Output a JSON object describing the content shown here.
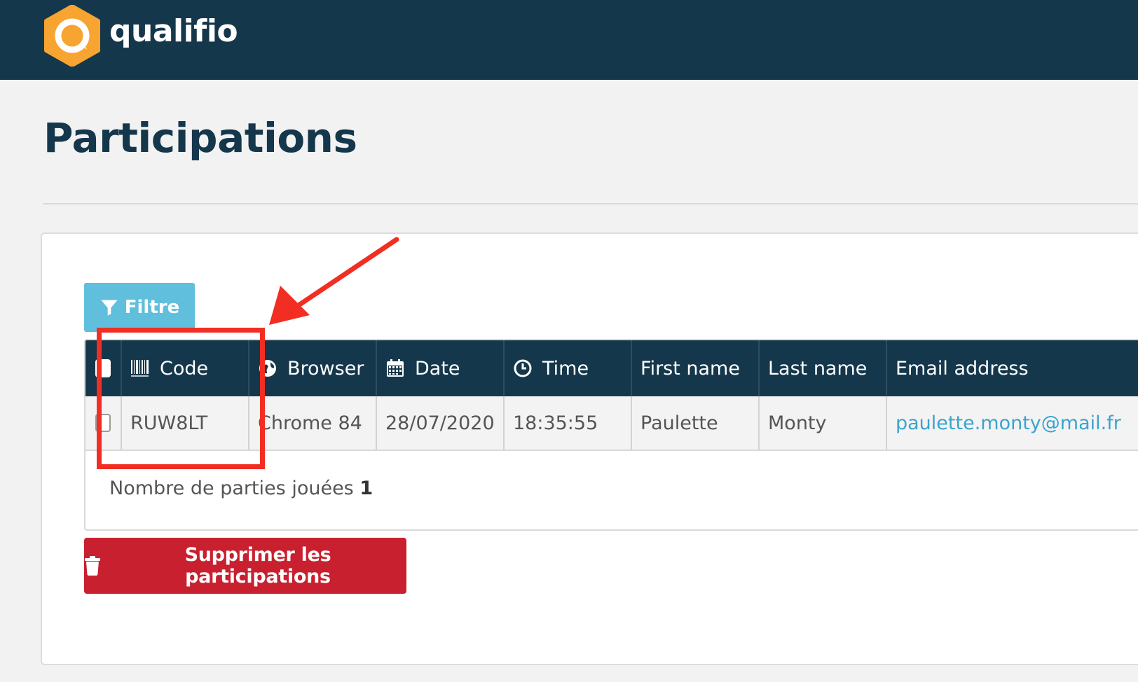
{
  "header": {
    "brand": "qualifio",
    "logo_icon": "qualifio-logo-icon",
    "brand_color": "#15374b",
    "logo_color": "#f7a430"
  },
  "page": {
    "title": "Participations"
  },
  "toolbar": {
    "filter_label": "Filtre",
    "filter_icon": "filter-icon",
    "filter_color": "#5fbfdc"
  },
  "table": {
    "columns": [
      {
        "key": "select",
        "label": "",
        "icon": "checkbox"
      },
      {
        "key": "code",
        "label": "Code",
        "icon": "barcode-icon"
      },
      {
        "key": "browser",
        "label": "Browser",
        "icon": "globe-icon"
      },
      {
        "key": "date",
        "label": "Date",
        "icon": "calendar-icon"
      },
      {
        "key": "time",
        "label": "Time",
        "icon": "clock-icon"
      },
      {
        "key": "first_name",
        "label": "First name",
        "icon": ""
      },
      {
        "key": "last_name",
        "label": "Last name",
        "icon": ""
      },
      {
        "key": "email",
        "label": "Email address",
        "icon": ""
      }
    ],
    "rows": [
      {
        "code": "RUW8LT",
        "browser": "Chrome 84",
        "date": "28/07/2020",
        "time": "18:35:55",
        "first_name": "Paulette",
        "last_name": "Monty",
        "email": "paulette.monty@mail.fr"
      }
    ],
    "footer": {
      "count_label": "Nombre de parties jouées",
      "count_value": "1"
    }
  },
  "actions": {
    "delete_label": "Supprimer les participations",
    "delete_icon": "trash-icon",
    "delete_color": "#c8202f"
  },
  "annotation": {
    "color": "#f22e22",
    "shapes": [
      "highlight-box",
      "arrow"
    ]
  }
}
